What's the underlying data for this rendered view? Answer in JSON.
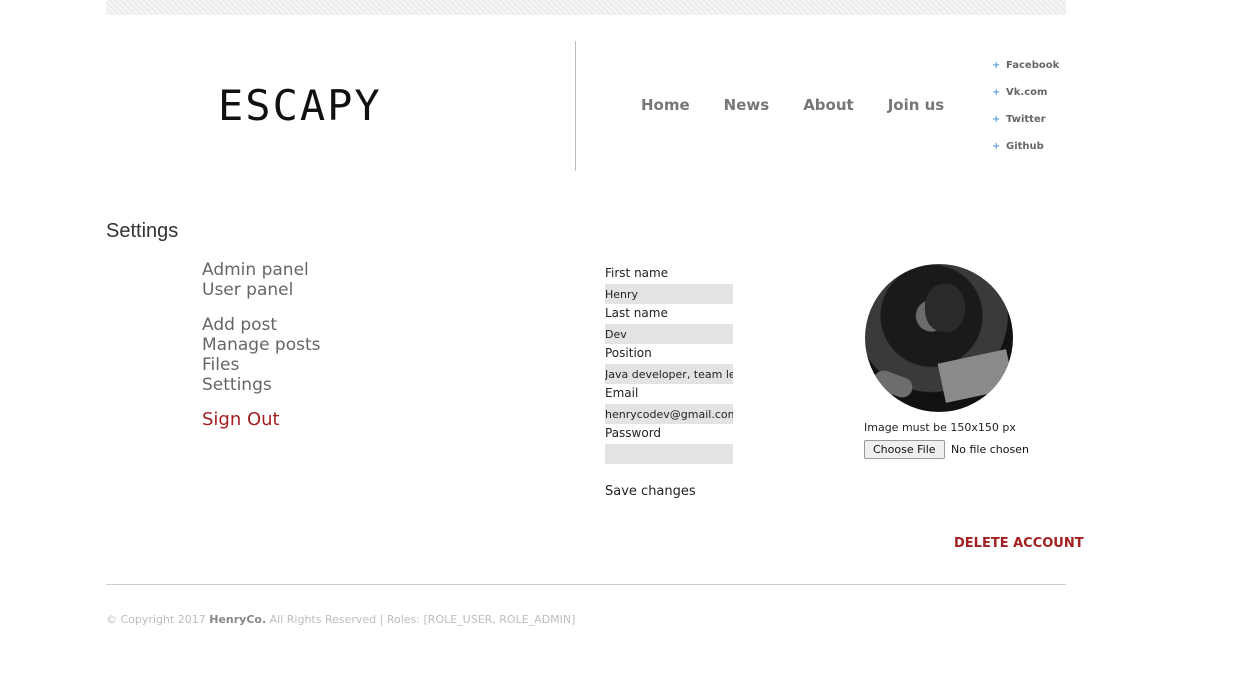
{
  "logo": "ESCAPY",
  "main_nav": [
    "Home",
    "News",
    "About",
    "Join us"
  ],
  "social_nav": {
    "bullet": "+",
    "items": [
      "Facebook",
      "Vk.com",
      "Twitter",
      "Github"
    ]
  },
  "page_title": "Settings",
  "sidebar": {
    "group1": [
      "Admin panel",
      "User panel"
    ],
    "group2": [
      "Add post",
      "Manage posts",
      "Files",
      "Settings"
    ],
    "sign_out": "Sign Out"
  },
  "form": {
    "first_name": {
      "label": "First name",
      "value": "Henry"
    },
    "last_name": {
      "label": "Last name",
      "value": "Dev"
    },
    "position": {
      "label": "Position",
      "value": "Java developer, team le"
    },
    "email": {
      "label": "Email",
      "value": "henrycodev@gmail.com"
    },
    "password": {
      "label": "Password",
      "value": ""
    },
    "save_label": "Save changes"
  },
  "avatar": {
    "note": "Image must be 150x150 px",
    "choose_file_label": "Choose File",
    "file_status": "No file chosen"
  },
  "delete_account": "DELETE ACCOUNT",
  "footer": {
    "prefix": "© Copyright 2017 ",
    "brand": "HenryCo.",
    "suffix": " All Rights Reserved | Roles: [ROLE_USER, ROLE_ADMIN]"
  },
  "colors": {
    "accent": "#a32020",
    "social_bullet": "#3a88d6"
  }
}
